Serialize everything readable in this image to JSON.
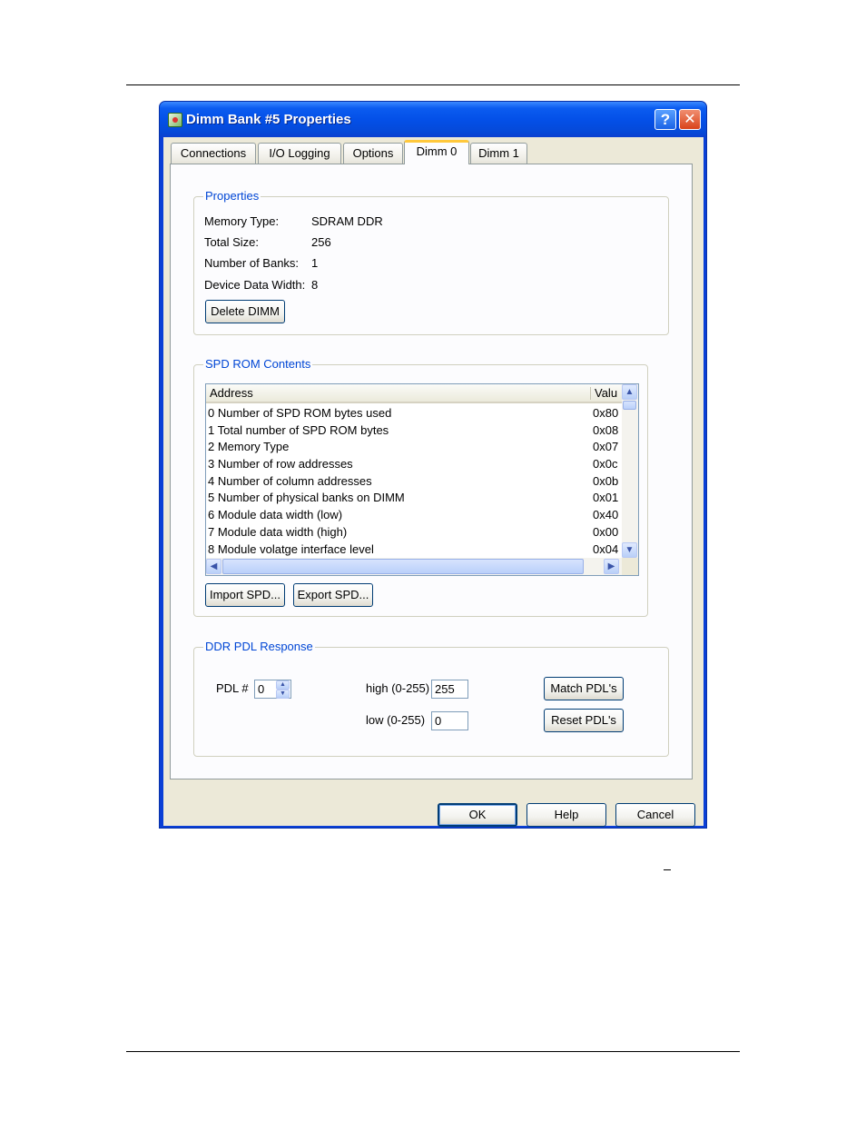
{
  "window": {
    "title": "Dimm Bank #5 Properties",
    "help_glyph": "?",
    "close_glyph": "✕"
  },
  "tabs": [
    {
      "label": "Connections",
      "active": false
    },
    {
      "label": "I/O Logging",
      "active": false
    },
    {
      "label": "Options",
      "active": false
    },
    {
      "label": "Dimm 0",
      "active": true
    },
    {
      "label": "Dimm 1",
      "active": false
    }
  ],
  "properties": {
    "legend": "Properties",
    "memory_type_label": "Memory Type:",
    "memory_type_value": "SDRAM DDR",
    "total_size_label": "Total Size:",
    "total_size_value": "256",
    "num_banks_label": "Number of Banks:",
    "num_banks_value": "1",
    "device_width_label": "Device Data Width:",
    "device_width_value": "8",
    "delete_button": "Delete DIMM"
  },
  "spd": {
    "legend": "SPD ROM Contents",
    "columns": [
      "Address",
      "Valu"
    ],
    "rows": [
      {
        "address": "0 Number of SPD ROM bytes used",
        "value": "0x80"
      },
      {
        "address": "1 Total number of SPD ROM bytes",
        "value": "0x08"
      },
      {
        "address": "2 Memory Type",
        "value": "0x07"
      },
      {
        "address": "3 Number of row addresses",
        "value": "0x0c"
      },
      {
        "address": "4 Number of column addresses",
        "value": "0x0b"
      },
      {
        "address": "5 Number of physical banks on DIMM",
        "value": "0x01"
      },
      {
        "address": "6 Module data width (low)",
        "value": "0x40"
      },
      {
        "address": "7 Module data width (high)",
        "value": "0x00"
      },
      {
        "address": "8 Module volatge interface level",
        "value": "0x04"
      }
    ],
    "import_button": "Import SPD...",
    "export_button": "Export SPD..."
  },
  "pdl": {
    "legend": "DDR PDL Response",
    "pdl_label": "PDL #",
    "pdl_value": "0",
    "high_label": "high (0-255)",
    "high_value": "255",
    "low_label": "low (0-255)",
    "low_value": "0",
    "match_button": "Match PDL's",
    "reset_button": "Reset PDL's"
  },
  "footer": {
    "ok": "OK",
    "help": "Help",
    "cancel": "Cancel"
  }
}
